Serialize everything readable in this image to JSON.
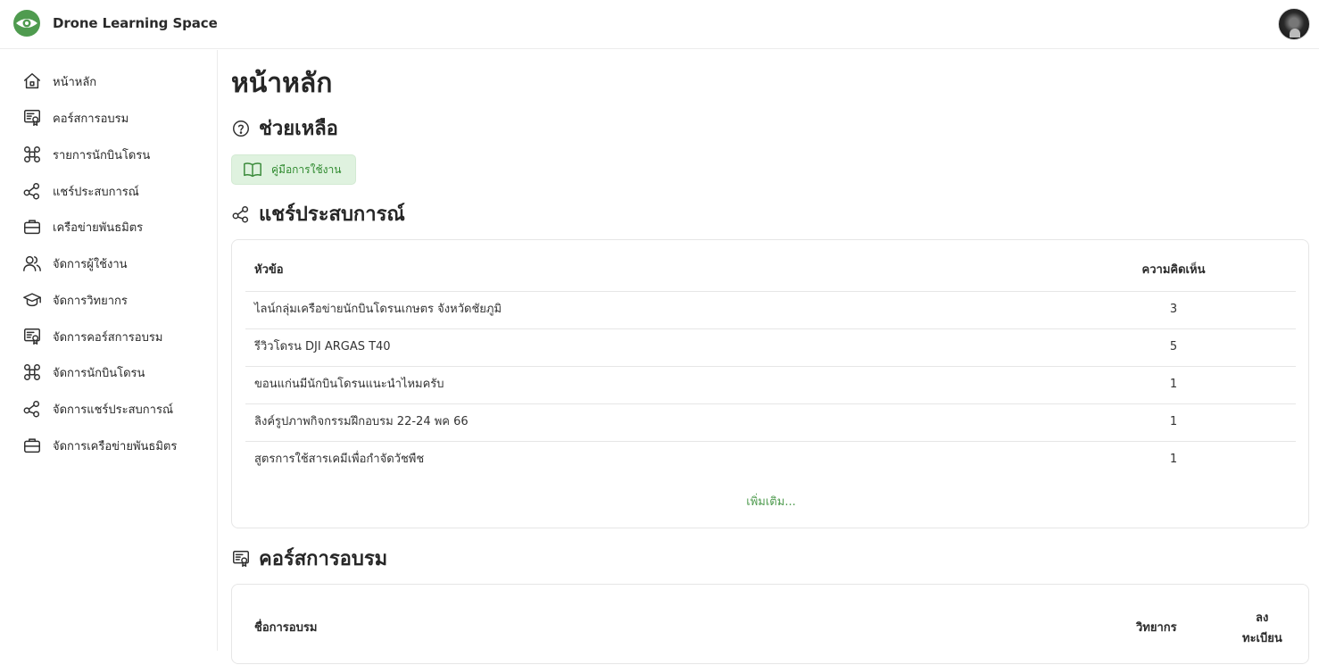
{
  "brand": {
    "name": "Drone Learning Space",
    "logo_icon": "drone-eye-logo-icon",
    "accent": "#4f9b4f"
  },
  "sidebar": {
    "items": [
      {
        "label": "หน้าหลัก",
        "icon": "home-icon"
      },
      {
        "label": "คอร์สการอบรม",
        "icon": "certificate-icon"
      },
      {
        "label": "รายการนักบินโดรน",
        "icon": "drone-icon"
      },
      {
        "label": "แชร์ประสบการณ์",
        "icon": "share-icon"
      },
      {
        "label": "เครือข่ายพันธมิตร",
        "icon": "briefcase-icon"
      },
      {
        "label": "จัดการผู้ใช้งาน",
        "icon": "users-icon"
      },
      {
        "label": "จัดการวิทยากร",
        "icon": "graduation-cap-icon"
      },
      {
        "label": "จัดการคอร์สการอบรม",
        "icon": "certificate-icon"
      },
      {
        "label": "จัดการนักบินโดรน",
        "icon": "drone-icon"
      },
      {
        "label": "จัดการแชร์ประสบการณ์",
        "icon": "share-icon"
      },
      {
        "label": "จัดการเครือข่ายพันธมิตร",
        "icon": "briefcase-icon"
      }
    ]
  },
  "main": {
    "page_title": "หน้าหลัก",
    "help": {
      "title": "ช่วยเหลือ",
      "button_label": "คู่มือการใช้งาน"
    },
    "share": {
      "title": "แชร์ประสบการณ์",
      "columns": [
        "หัวข้อ",
        "ความคิดเห็น"
      ],
      "rows": [
        {
          "topic": "ไลน์กลุ่มเครือข่ายนักบินโดรนเกษตร จังหวัดชัยภูมิ",
          "comments": "3"
        },
        {
          "topic": "รีวิวโดรน DJI ARGAS T40",
          "comments": "5"
        },
        {
          "topic": "ขอนแก่นมีนักบินโดรนแนะนำไหมครับ",
          "comments": "1"
        },
        {
          "topic": "ลิงค์รูปภาพกิจกรรมฝึกอบรม 22-24 พค 66",
          "comments": "1"
        },
        {
          "topic": "สูตรการใช้สารเคมีเพื่อกำจัดวัชพืช",
          "comments": "1"
        }
      ],
      "more_label": "เพิ่มเติม..."
    },
    "courses": {
      "title": "คอร์สการอบรม",
      "columns": {
        "name": "ชื่อการอบรม",
        "instructor": "วิทยากร",
        "register_line1": "ลง",
        "register_line2": "ทะเบียน"
      }
    }
  }
}
